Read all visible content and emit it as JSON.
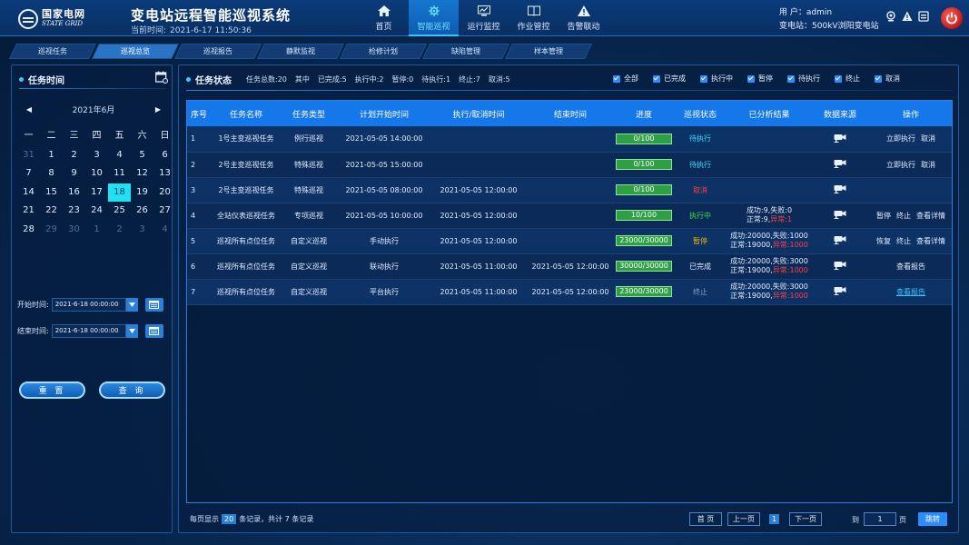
{
  "header": {
    "logo_cn": "国家电网",
    "logo_en": "STATE GRID",
    "title": "变电站远程智能巡视系统",
    "time_label": "当前时间:",
    "time_value": "2021-6-17  11:50:36",
    "user_label": "用    户：",
    "user_name": "admin",
    "station_label": "变电站：",
    "station_name": "500kV浏阳变电站"
  },
  "nav": [
    {
      "label": "首页",
      "icon": "home-icon"
    },
    {
      "label": "智能巡视",
      "icon": "gear-icon",
      "active": true
    },
    {
      "label": "运行监控",
      "icon": "monitor-icon"
    },
    {
      "label": "作业管控",
      "icon": "book-icon"
    },
    {
      "label": "告警联动",
      "icon": "warning-icon"
    }
  ],
  "subtabs": [
    "巡视任务",
    "巡视总览",
    "巡视报告",
    "静默监视",
    "检修计划",
    "缺陷管理",
    "样本管理"
  ],
  "left": {
    "title": "任务时间",
    "month": "2021年6月",
    "weekdays": [
      "一",
      "二",
      "三",
      "四",
      "五",
      "六",
      "日"
    ],
    "days": [
      "31",
      "1",
      "2",
      "3",
      "4",
      "5",
      "6",
      "7",
      "8",
      "9",
      "10",
      "11",
      "12",
      "13",
      "14",
      "15",
      "16",
      "17",
      "18",
      "19",
      "20",
      "21",
      "22",
      "23",
      "24",
      "25",
      "26",
      "27",
      "28",
      "29",
      "30",
      "1",
      "2",
      "3",
      "4"
    ],
    "start_label": "开始时间:",
    "start_value": "2021-6-18  00:00:00",
    "end_label": "结束时间:",
    "end_value": "2021-6-18  00:00:00",
    "reset_label": "重 置",
    "query_label": "查 询"
  },
  "right": {
    "title": "任务状态",
    "stats": [
      "任务总数:20",
      "其中",
      "已完成:5",
      "执行中:2",
      "暂停:0",
      "待执行:1",
      "终止:7",
      "取消:5"
    ],
    "filters": [
      "全部",
      "已完成",
      "执行中",
      "暂停",
      "待执行",
      "终止",
      "取消"
    ],
    "columns": [
      "序号",
      "任务名称",
      "任务类型",
      "计划开始时间",
      "执行/取消时间",
      "结束时间",
      "进度",
      "巡视状态",
      "已分析结果",
      "数据来源",
      "操作"
    ],
    "rows": [
      {
        "no": "1",
        "name": "1号主变巡视任务",
        "type": "例行巡视",
        "plan": "2021-05-05  14:00:00",
        "exec": "",
        "end": "",
        "progress": "0/100",
        "progress_pct": 0,
        "status": "待执行",
        "status_cls": "st-wait",
        "res1": "",
        "res2a": "",
        "res2b": "",
        "ops": [
          "立即执行",
          "取消"
        ]
      },
      {
        "no": "2",
        "name": "2号主变巡视任务",
        "type": "特殊巡视",
        "plan": "2021-05-05  15:00:00",
        "exec": "",
        "end": "",
        "progress": "0/100",
        "progress_pct": 0,
        "status": "待执行",
        "status_cls": "st-wait",
        "res1": "",
        "res2a": "",
        "res2b": "",
        "ops": [
          "立即执行",
          "取消"
        ]
      },
      {
        "no": "3",
        "name": "2号主变巡视任务",
        "type": "特殊巡视",
        "plan": "2021-05-05  08:00:00",
        "exec": "2021-05-05  12:00:00",
        "end": "",
        "progress": "0/100",
        "progress_pct": 0,
        "status": "取消",
        "status_cls": "st-cancel",
        "res1": "",
        "res2a": "",
        "res2b": "",
        "ops": []
      },
      {
        "no": "4",
        "name": "全站仪表巡视任务",
        "type": "专项巡视",
        "plan": "2021-05-05  10:00:00",
        "exec": "2021-05-05  12:00:00",
        "end": "",
        "progress": "10/100",
        "progress_pct": 10,
        "status": "执行中",
        "status_cls": "st-run",
        "res1": "成功:9,失败:0",
        "res2a": "正常:9,",
        "res2b": "异常:1",
        "ops": [
          "暂停",
          "终止",
          "查看详情"
        ]
      },
      {
        "no": "5",
        "name": "巡视所有点位任务",
        "type": "自定义巡视",
        "plan": "手动执行",
        "exec": "2021-05-05  12:00:00",
        "end": "",
        "progress": "23000/30000",
        "progress_pct": 76.7,
        "status": "暂停",
        "status_cls": "st-pause",
        "res1": "成功:20000,失败:1000",
        "res2a": "正常:19000,",
        "res2b": "异常:1000",
        "ops": [
          "恢复",
          "终止",
          "查看详情"
        ]
      },
      {
        "no": "6",
        "name": "巡视所有点位任务",
        "type": "自定义巡视",
        "plan": "联动执行",
        "exec": "2021-05-05  11:00:00",
        "end": "2021-05-05  12:00:00",
        "progress": "30000/30000",
        "progress_pct": 100,
        "status": "已完成",
        "status_cls": "st-done",
        "res1": "成功:20000,失败:3000",
        "res2a": "正常:19000,",
        "res2b": "异常:1000",
        "ops": [
          "查看报告"
        ]
      },
      {
        "no": "7",
        "name": "巡视所有点位任务",
        "type": "自定义巡视",
        "plan": "平台执行",
        "exec": "2021-05-05  11:00:00",
        "end": "2021-05-05  12:00:00",
        "progress": "23000/30000",
        "progress_pct": 76.7,
        "status": "终止",
        "status_cls": "st-stop",
        "res1": "成功:20000,失败:3000",
        "res2a": "正常:19000,",
        "res2b": "异常:1000",
        "ops": [
          "查看报告"
        ],
        "ops_link": true
      }
    ]
  },
  "pager": {
    "prefix": "每页显示",
    "size": "20",
    "suffix": "条记录，共计 7 条记录",
    "first": "首  页",
    "prev": "上一页",
    "current": "1",
    "next": "下一页",
    "to": "到",
    "page_value": "1",
    "page_unit": "页",
    "go": "跳转"
  },
  "colors": {
    "accent": "#1477ea",
    "selected_day": "#1fe1f1",
    "progress": "#2ea043",
    "danger": "#ff4040"
  }
}
